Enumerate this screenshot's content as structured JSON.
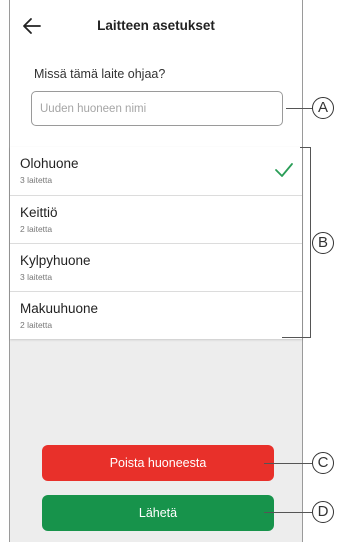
{
  "header": {
    "title": "Laitteen asetukset",
    "back_icon": "arrow-left-icon"
  },
  "form": {
    "question": "Missä tämä laite ohjaa?",
    "room_name_placeholder": "Uuden huoneen nimi",
    "room_name_value": ""
  },
  "rooms": [
    {
      "name": "Olohuone",
      "count": "3 laitetta",
      "selected": true
    },
    {
      "name": "Keittiö",
      "count": "2 laitetta",
      "selected": false
    },
    {
      "name": "Kylpyhuone",
      "count": "3 laitetta",
      "selected": false
    },
    {
      "name": "Makuuhuone",
      "count": "2 laitetta",
      "selected": false
    }
  ],
  "actions": {
    "remove_label": "Poista huoneesta",
    "send_label": "Lähetä"
  },
  "callouts": {
    "a": "A",
    "b": "B",
    "c": "C",
    "d": "D"
  },
  "colors": {
    "remove": "#e8302a",
    "send": "#17934b",
    "check": "#2a9d57",
    "background": "#ededed"
  }
}
